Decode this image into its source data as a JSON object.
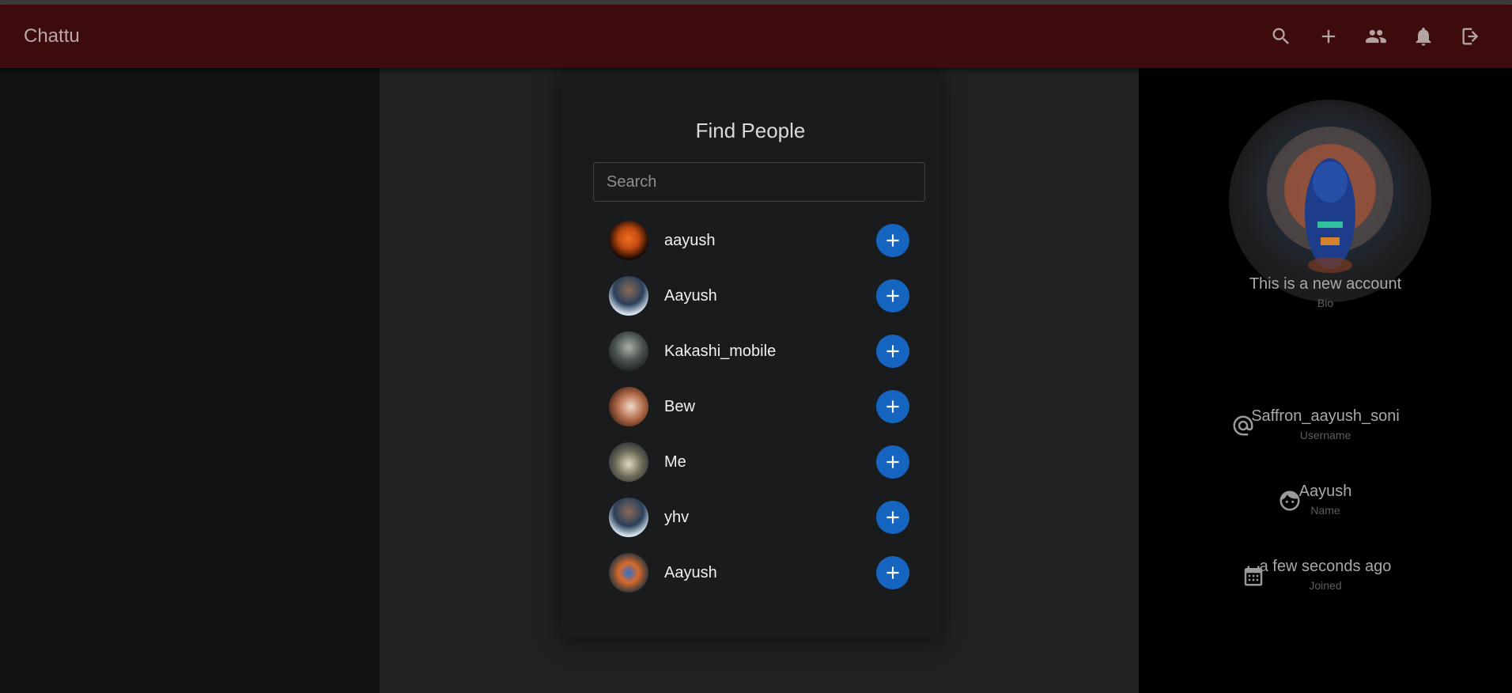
{
  "app": {
    "title": "Chattu"
  },
  "appbar": {
    "icons": [
      "search-icon",
      "add-icon",
      "people-icon",
      "bell-icon",
      "logout-icon"
    ]
  },
  "find_people": {
    "title": "Find People",
    "search_placeholder": "Search",
    "people": [
      {
        "name": "aayush"
      },
      {
        "name": "Aayush"
      },
      {
        "name": "Kakashi_mobile"
      },
      {
        "name": "Bew"
      },
      {
        "name": "Me"
      },
      {
        "name": "yhv"
      },
      {
        "name": "Aayush"
      }
    ]
  },
  "profile": {
    "bio": "This is a new account",
    "bio_label": "Bio",
    "username": "Saffron_aayush_soni",
    "username_label": "Username",
    "name": "Aayush",
    "name_label": "Name",
    "joined": "a few seconds ago",
    "joined_label": "Joined"
  },
  "colors": {
    "appbar": "#3e0b0d",
    "add_button": "#1565c0",
    "card": "#1a1b1c",
    "right_pane": "#000000"
  }
}
